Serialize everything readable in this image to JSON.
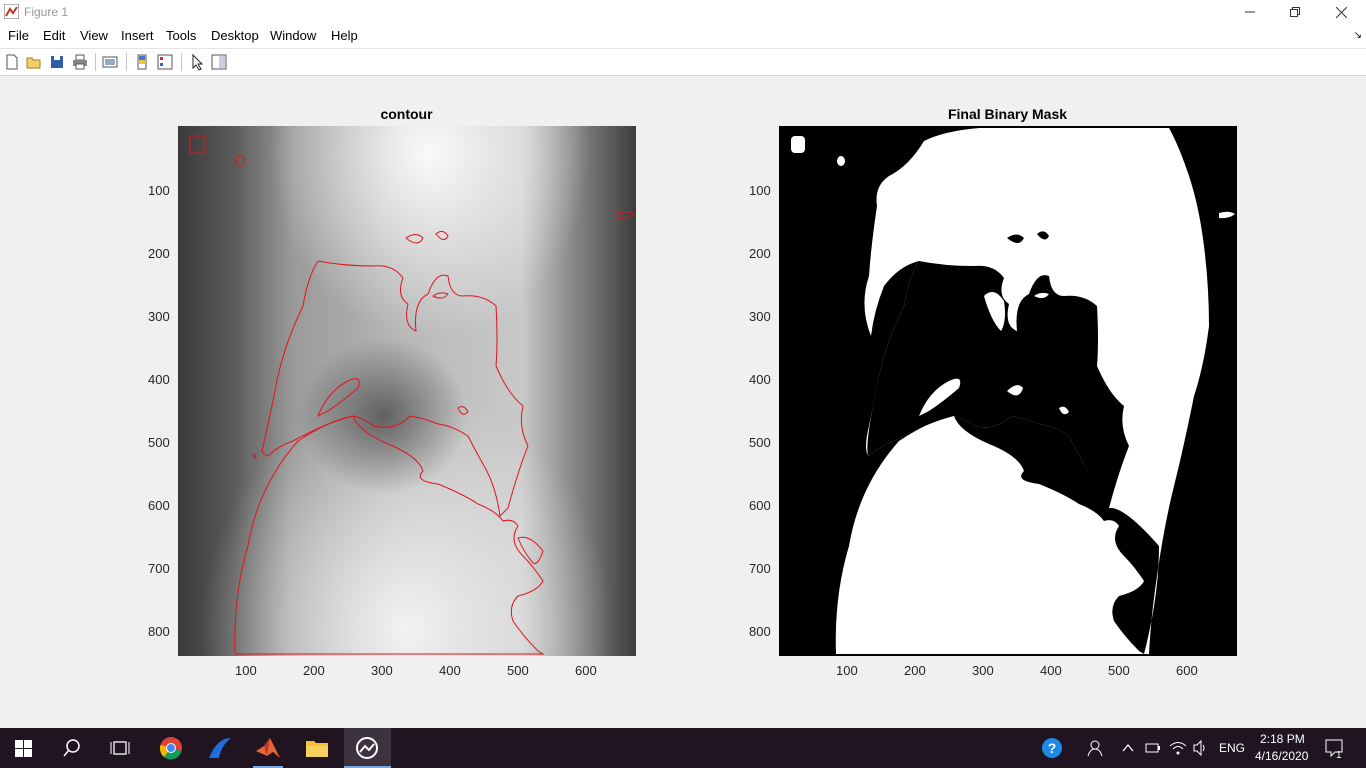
{
  "window": {
    "title": "Figure 1"
  },
  "menu": [
    "File",
    "Edit",
    "View",
    "Insert",
    "Tools",
    "Desktop",
    "Window",
    "Help"
  ],
  "toolbar": {
    "icons": [
      "new-figure-icon",
      "open-file-icon",
      "save-icon",
      "print-icon",
      "link-plot-icon",
      "insert-colorbar-icon",
      "insert-legend-icon",
      "pointer-icon",
      "property-editor-icon"
    ]
  },
  "plots": [
    {
      "title": "contour",
      "yticks": [
        "100",
        "200",
        "300",
        "400",
        "500",
        "600",
        "700",
        "800"
      ],
      "xticks": [
        "100",
        "200",
        "300",
        "400",
        "500",
        "600"
      ]
    },
    {
      "title": "Final Binary Mask",
      "yticks": [
        "100",
        "200",
        "300",
        "400",
        "500",
        "600",
        "700",
        "800"
      ],
      "xticks": [
        "100",
        "200",
        "300",
        "400",
        "500",
        "600"
      ]
    }
  ],
  "taskbar": {
    "lang": "ENG",
    "time": "2:18 PM",
    "date": "4/16/2020",
    "notifications": "1"
  },
  "colors": {
    "contour": "#e0141e",
    "taskbar": "#1f1420"
  }
}
